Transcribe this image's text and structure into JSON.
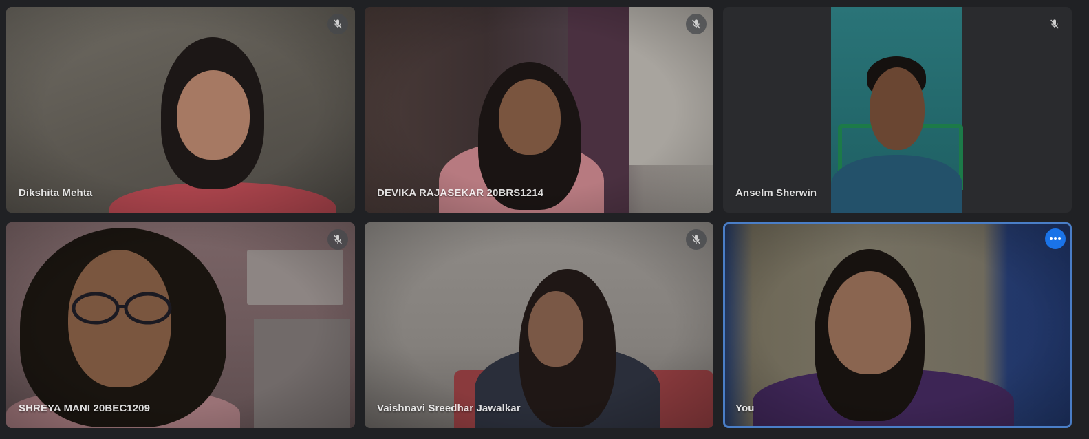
{
  "participants": [
    {
      "name": "Dikshita Mehta",
      "muted": true
    },
    {
      "name": "DEVIKA RAJASEKAR 20BRS1214",
      "muted": true
    },
    {
      "name": "Anselm Sherwin",
      "muted": true
    },
    {
      "name": "SHREYA MANI 20BEC1209",
      "muted": true
    },
    {
      "name": "Vaishnavi Sreedhar Jawalkar",
      "muted": true
    },
    {
      "name": "You",
      "muted": false,
      "is_self": true
    }
  ],
  "icons": {
    "mute": "mic-off-icon",
    "more": "more-options-icon"
  },
  "colors": {
    "background": "#202124",
    "self_highlight": "#4a7ec7",
    "more_button": "#1a73e8"
  }
}
